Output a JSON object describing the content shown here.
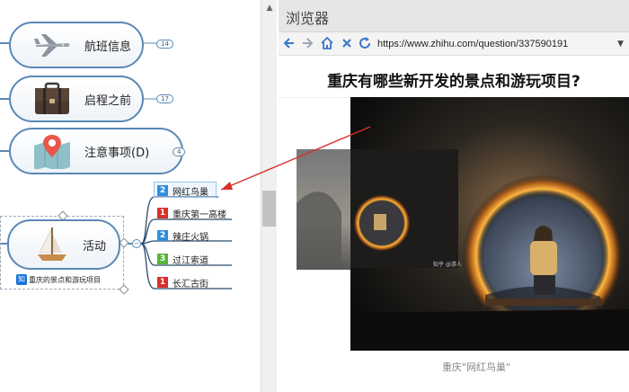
{
  "mindmap": {
    "nodes": [
      {
        "label": "航班信息",
        "badge": "14",
        "icon": "airplane-icon"
      },
      {
        "label": "启程之前",
        "badge": "17",
        "icon": "briefcase-icon"
      },
      {
        "label": "注意事项(D)",
        "badge": "4",
        "icon": "map-pin-icon"
      }
    ],
    "activity": {
      "label": "活动",
      "icon": "sailboat-icon",
      "note_icon": "知",
      "note": "重庆的景点和游玩项目",
      "collapse_symbol": "−"
    },
    "subtopics": [
      {
        "num": "2",
        "label": "网红鸟巢",
        "color": "#2f8fdc"
      },
      {
        "num": "1",
        "label": "重庆第一高楼",
        "color": "#d9302a"
      },
      {
        "num": "2",
        "label": "辣庄火锅",
        "color": "#2f8fdc"
      },
      {
        "num": "3",
        "label": "过江索道",
        "color": "#58b33c"
      },
      {
        "num": "1",
        "label": "长汇古街",
        "color": "#d9302a"
      }
    ],
    "accent": "#5a88b6"
  },
  "browser": {
    "title": "浏览器",
    "url": "https://www.zhihu.com/question/337590191",
    "nav": {
      "back": "back-arrow-icon",
      "forward": "forward-arrow-icon",
      "home": "home-icon",
      "close": "close-icon",
      "refresh": "refresh-icon"
    },
    "page_title": "重庆有哪些新开发的景点和游玩项目?",
    "caption": "重庆\"网红鸟巢\"",
    "small_watermark": "知乎 @游人"
  }
}
